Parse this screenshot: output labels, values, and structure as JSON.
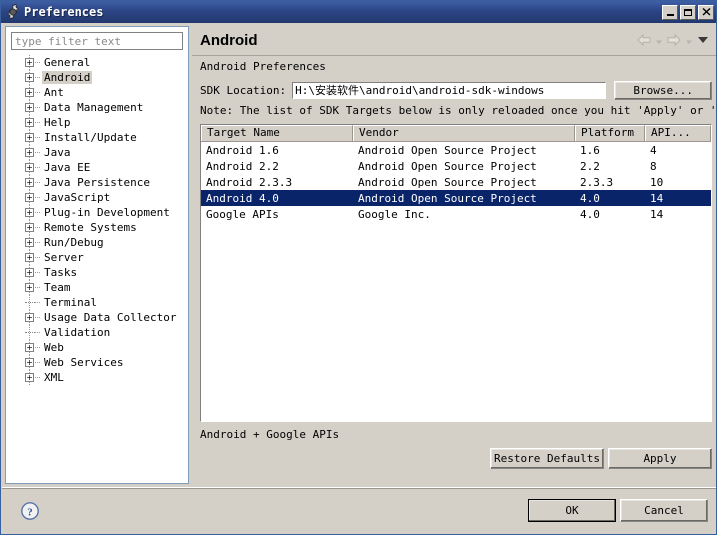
{
  "window": {
    "title": "Preferences",
    "title_icon": "gear-icon",
    "controls": {
      "minimize": "_",
      "maximize": "□",
      "close": "✕"
    }
  },
  "sidebar": {
    "filter": {
      "placeholder": "type filter text",
      "value": ""
    },
    "items": [
      {
        "label": "General",
        "expandable": true,
        "selected": false
      },
      {
        "label": "Android",
        "expandable": true,
        "selected": true
      },
      {
        "label": "Ant",
        "expandable": true,
        "selected": false
      },
      {
        "label": "Data Management",
        "expandable": true,
        "selected": false
      },
      {
        "label": "Help",
        "expandable": true,
        "selected": false
      },
      {
        "label": "Install/Update",
        "expandable": true,
        "selected": false
      },
      {
        "label": "Java",
        "expandable": true,
        "selected": false
      },
      {
        "label": "Java EE",
        "expandable": true,
        "selected": false
      },
      {
        "label": "Java Persistence",
        "expandable": true,
        "selected": false
      },
      {
        "label": "JavaScript",
        "expandable": true,
        "selected": false
      },
      {
        "label": "Plug-in Development",
        "expandable": true,
        "selected": false
      },
      {
        "label": "Remote Systems",
        "expandable": true,
        "selected": false
      },
      {
        "label": "Run/Debug",
        "expandable": true,
        "selected": false
      },
      {
        "label": "Server",
        "expandable": true,
        "selected": false
      },
      {
        "label": "Tasks",
        "expandable": true,
        "selected": false
      },
      {
        "label": "Team",
        "expandable": true,
        "selected": false
      },
      {
        "label": "Terminal",
        "expandable": false,
        "selected": false
      },
      {
        "label": "Usage Data Collector",
        "expandable": true,
        "selected": false
      },
      {
        "label": "Validation",
        "expandable": false,
        "selected": false
      },
      {
        "label": "Web",
        "expandable": true,
        "selected": false
      },
      {
        "label": "Web Services",
        "expandable": true,
        "selected": false
      },
      {
        "label": "XML",
        "expandable": true,
        "selected": false
      }
    ]
  },
  "main": {
    "title": "Android",
    "nav": {
      "back_icon": "back-arrow-icon",
      "back_menu_icon": "chevron-down-icon",
      "forward_icon": "forward-arrow-icon",
      "forward_menu_icon": "chevron-down-icon",
      "menu_icon": "chevron-down-icon"
    },
    "section_label": "Android Preferences",
    "sdk": {
      "label": "SDK Location:",
      "value": "H:\\安装软件\\android\\android-sdk-windows",
      "browse_label": "Browse..."
    },
    "note": "Note: The list of SDK Targets below is only reloaded once you hit 'Apply' or 'OK'.",
    "table": {
      "columns": [
        "Target Name",
        "Vendor",
        "Platform",
        "API..."
      ],
      "rows": [
        {
          "cells": [
            "Android 1.6",
            "Android Open Source Project",
            "1.6",
            "4"
          ],
          "selected": false
        },
        {
          "cells": [
            "Android 2.2",
            "Android Open Source Project",
            "2.2",
            "8"
          ],
          "selected": false
        },
        {
          "cells": [
            "Android 2.3.3",
            "Android Open Source Project",
            "2.3.3",
            "10"
          ],
          "selected": false
        },
        {
          "cells": [
            "Android 4.0",
            "Android Open Source Project",
            "4.0",
            "14"
          ],
          "selected": true
        },
        {
          "cells": [
            "Google APIs",
            "Google Inc.",
            "4.0",
            "14"
          ],
          "selected": false
        }
      ]
    },
    "status": "Android + Google APIs",
    "restore_defaults_label": "Restore Defaults",
    "apply_label": "Apply"
  },
  "footer": {
    "help_icon": "help-question-icon",
    "ok_label": "OK",
    "cancel_label": "Cancel"
  },
  "colors": {
    "titlebar_start": "#3f5fa6",
    "titlebar_end": "#22386e",
    "dialog_bg": "#d4d0c8",
    "selection": "#0a246a",
    "field_bg": "#ffffff"
  }
}
